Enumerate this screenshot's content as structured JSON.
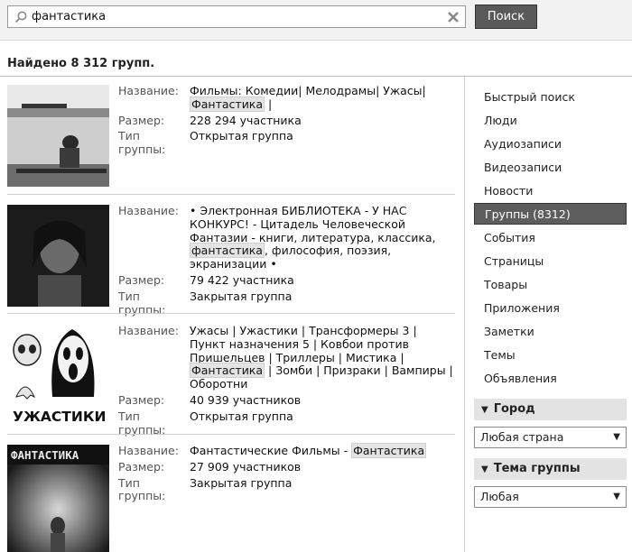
{
  "search": {
    "value": "фантастика",
    "button_label": "Поиск"
  },
  "found_text": "Найдено 8 312 групп.",
  "labels": {
    "name": "Название:",
    "size": "Размер:",
    "type": "Тип группы:"
  },
  "results": [
    {
      "name_parts": [
        "Фильмы: Комедии| Мелодрамы| Ужасы|",
        "Фантастика",
        "|"
      ],
      "size": "228 294 участника",
      "type": "Открытая группа"
    },
    {
      "name_parts": [
        "• Электронная БИБЛИОТЕКА - У НАС КОНКУРС! - Цитадель Человеческой Фантазии - книги, литература, классика,",
        "фантастика",
        ", философия, поэзия, экранизации •"
      ],
      "size": "79 422 участника",
      "type": "Закрытая группа"
    },
    {
      "name_parts": [
        "Ужасы | Ужастики | Трансформеры 3 | Пункт назначения 5 | Ковбои против Пришельцев | Триллеры | Мистика |",
        "Фантастика",
        "| Зомби | Призраки | Вампиры | Оборотни"
      ],
      "size": "40 939 участников",
      "type": "Открытая группа",
      "thumb_text": "УЖАСТИКИ"
    },
    {
      "name_parts": [
        "Фантастические Фильмы -",
        "Фантастика",
        ""
      ],
      "size": "27 909 участников",
      "type": "Закрытая группа",
      "thumb_text": "ФАНТАСТИКА"
    }
  ],
  "sidebar": {
    "items": [
      {
        "label": "Быстрый поиск"
      },
      {
        "label": "Люди"
      },
      {
        "label": "Аудиозаписи"
      },
      {
        "label": "Видеозаписи"
      },
      {
        "label": "Новости"
      },
      {
        "label": "Группы (8312)",
        "active": true
      },
      {
        "label": "События"
      },
      {
        "label": "Страницы"
      },
      {
        "label": "Товары"
      },
      {
        "label": "Приложения"
      },
      {
        "label": "Заметки"
      },
      {
        "label": "Темы"
      },
      {
        "label": "Объявления"
      }
    ],
    "city": {
      "header": "Город",
      "value": "Любая страна"
    },
    "topic": {
      "header": "Тема группы",
      "value": "Любая"
    }
  }
}
